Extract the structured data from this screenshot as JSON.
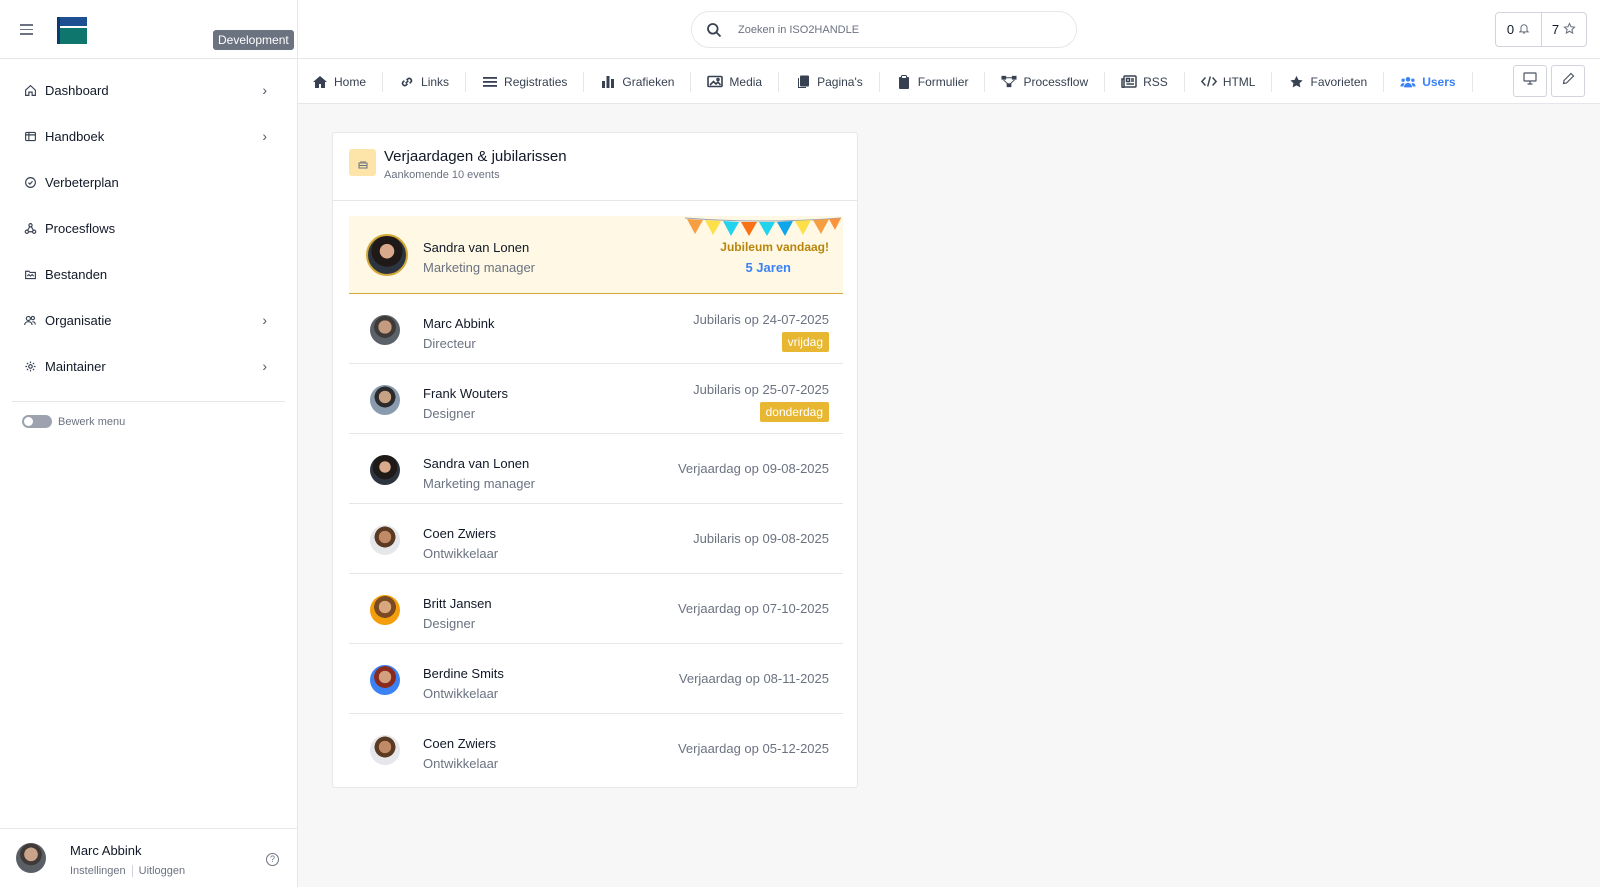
{
  "app": {
    "env_badge": "Development"
  },
  "sidebar": {
    "items": [
      {
        "label": "Dashboard",
        "icon": "home-icon",
        "chevron": true
      },
      {
        "label": "Handboek",
        "icon": "book-icon",
        "chevron": true
      },
      {
        "label": "Verbeterplan",
        "icon": "check-circle-icon",
        "chevron": false
      },
      {
        "label": "Procesflows",
        "icon": "flow-icon",
        "chevron": false
      },
      {
        "label": "Bestanden",
        "icon": "folder-icon",
        "chevron": false
      },
      {
        "label": "Organisatie",
        "icon": "users-icon",
        "chevron": true
      },
      {
        "label": "Maintainer",
        "icon": "gear-icon",
        "chevron": true
      }
    ],
    "edit_menu_label": "Bewerk menu",
    "user": {
      "name": "Marc Abbink",
      "settings_label": "Instellingen",
      "logout_label": "Uitloggen"
    }
  },
  "header": {
    "search_placeholder": "Zoeken in ISO2HANDLE",
    "notifications_count": "0",
    "favorites_count": "7"
  },
  "tabs": [
    {
      "label": "Home",
      "icon": "home-icon",
      "active": false
    },
    {
      "label": "Links",
      "icon": "link-icon",
      "active": false
    },
    {
      "label": "Registraties",
      "icon": "list-icon",
      "active": false
    },
    {
      "label": "Grafieken",
      "icon": "bar-chart-icon",
      "active": false
    },
    {
      "label": "Media",
      "icon": "image-icon",
      "active": false
    },
    {
      "label": "Pagina's",
      "icon": "pages-icon",
      "active": false
    },
    {
      "label": "Formulier",
      "icon": "clipboard-icon",
      "active": false
    },
    {
      "label": "Processflow",
      "icon": "sitemap-icon",
      "active": false
    },
    {
      "label": "RSS",
      "icon": "newspaper-icon",
      "active": false
    },
    {
      "label": "HTML",
      "icon": "code-icon",
      "active": false
    },
    {
      "label": "Favorieten",
      "icon": "star-icon",
      "active": false
    },
    {
      "label": "Users",
      "icon": "users-icon",
      "active": true
    }
  ],
  "card": {
    "title": "Verjaardagen & jubilarissen",
    "subtitle": "Aankomende 10 events",
    "highlight": {
      "name": "Sandra van Lonen",
      "role": "Marketing manager",
      "jubilee_text": "Jubileum vandaag!",
      "years": "5 Jaren"
    },
    "rows": [
      {
        "name": "Marc Abbink",
        "role": "Directeur",
        "event": "Jubilaris op 24-07-2025",
        "day": "vrijdag"
      },
      {
        "name": "Frank Wouters",
        "role": "Designer",
        "event": "Jubilaris op 25-07-2025",
        "day": "donderdag"
      },
      {
        "name": "Sandra van Lonen",
        "role": "Marketing manager",
        "event": "Verjaardag op 09-08-2025",
        "day": ""
      },
      {
        "name": "Coen Zwiers",
        "role": "Ontwikkelaar",
        "event": "Jubilaris op 09-08-2025",
        "day": ""
      },
      {
        "name": "Britt Jansen",
        "role": "Designer",
        "event": "Verjaardag op 07-10-2025",
        "day": ""
      },
      {
        "name": "Berdine Smits",
        "role": "Ontwikkelaar",
        "event": "Verjaardag op 08-11-2025",
        "day": ""
      },
      {
        "name": "Coen Zwiers",
        "role": "Ontwikkelaar",
        "event": "Verjaardag op 05-12-2025",
        "day": ""
      }
    ]
  },
  "colors": {
    "accent": "#3b82f6",
    "badge": "#e7b731",
    "highlight_bg": "#fef8e4",
    "jubilee_text": "#b8860b"
  }
}
